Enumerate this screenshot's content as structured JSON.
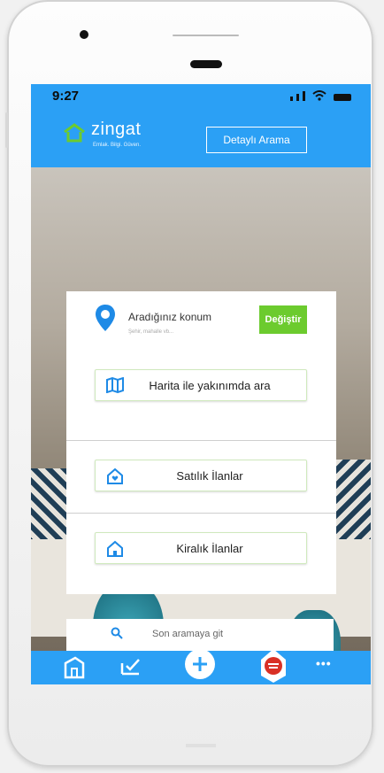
{
  "status_bar": {
    "time": "9:27"
  },
  "header": {
    "brand_name": "zingat",
    "brand_tagline": "Emlak. Bilgi. Güven.",
    "detailed_search_label": "Detaylı Arama"
  },
  "location": {
    "title": "Aradığınız konum",
    "hint": "Şehir, mahalle vb...",
    "change_label": "Değiştir"
  },
  "options": {
    "map_nearby": "Harita ile yakınımda ara",
    "for_sale": "Satılık İlanlar",
    "for_rent": "Kiralık İlanlar"
  },
  "recent_search": {
    "label": "Son aramaya git"
  },
  "tab_bar": {
    "more_label": "•••"
  },
  "colors": {
    "primary": "#2ba0f5",
    "accent_green": "#6ccb2e"
  }
}
